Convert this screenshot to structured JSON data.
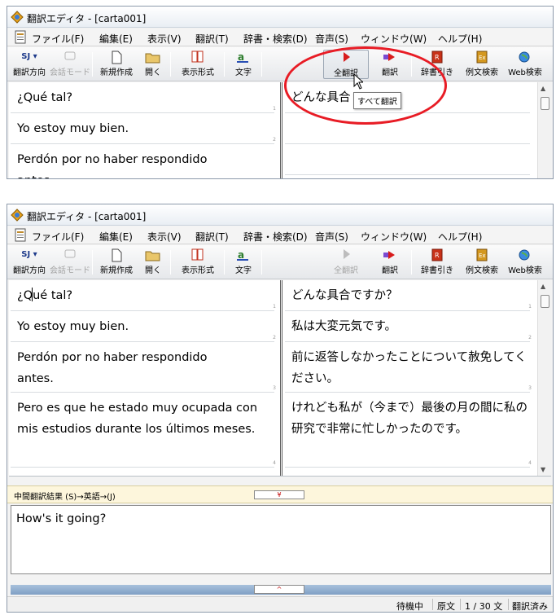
{
  "window": {
    "title": "翻訳エディタ - [carta001]"
  },
  "menu": [
    "ファイル(F)",
    "編集(E)",
    "表示(V)",
    "翻訳(T)",
    "辞書・検索(D)",
    "音声(S)",
    "ウィンドウ(W)",
    "ヘルプ(H)"
  ],
  "toolbar": {
    "direction_badge": "SJ ▾",
    "direction": "翻訳方向",
    "conversation": "会話モード",
    "new": "新規作成",
    "open": "開く",
    "display": "表示形式",
    "font": "文字",
    "translate_all": "全翻訳",
    "translate": "翻訳",
    "dict": "辞書引き",
    "example": "例文検索",
    "web": "Web検索"
  },
  "top_panel": {
    "source": [
      "¿Qué tal?",
      "Yo estoy muy bien.",
      "Perdón por no haber respondido antes."
    ],
    "target": [
      "どんな具合"
    ],
    "tooltip": "すべて翻訳"
  },
  "bottom_panel": {
    "source": [
      "¿Qué tal?",
      "Yo estoy muy bien.",
      "Perdón por no haber respondido antes.",
      "Pero es que he estado muy ocupada con mis estudios durante los últimos meses."
    ],
    "target": [
      "どんな具合ですか？",
      "私は大変元気です。",
      "前に返答しなかったことについて赦免してください。",
      "けれども私が（今まで）最後の月の間に私の研究で非常に忙しかったのです。"
    ],
    "seg_numbers": [
      "1",
      "2",
      "3",
      "4"
    ]
  },
  "intermediate": {
    "label": "中間翻訳結果 (S)→英語→(J)",
    "text": "How's it going?",
    "down_arrow": "¥",
    "up_arrow": "^"
  },
  "status": {
    "state": "待機中",
    "mode": "原文",
    "count": "1 / 30 文",
    "done": "翻訳済み"
  },
  "colors": {
    "highlight_ring": "#e81c25",
    "title_gradient_bottom": "#e9eef4"
  }
}
